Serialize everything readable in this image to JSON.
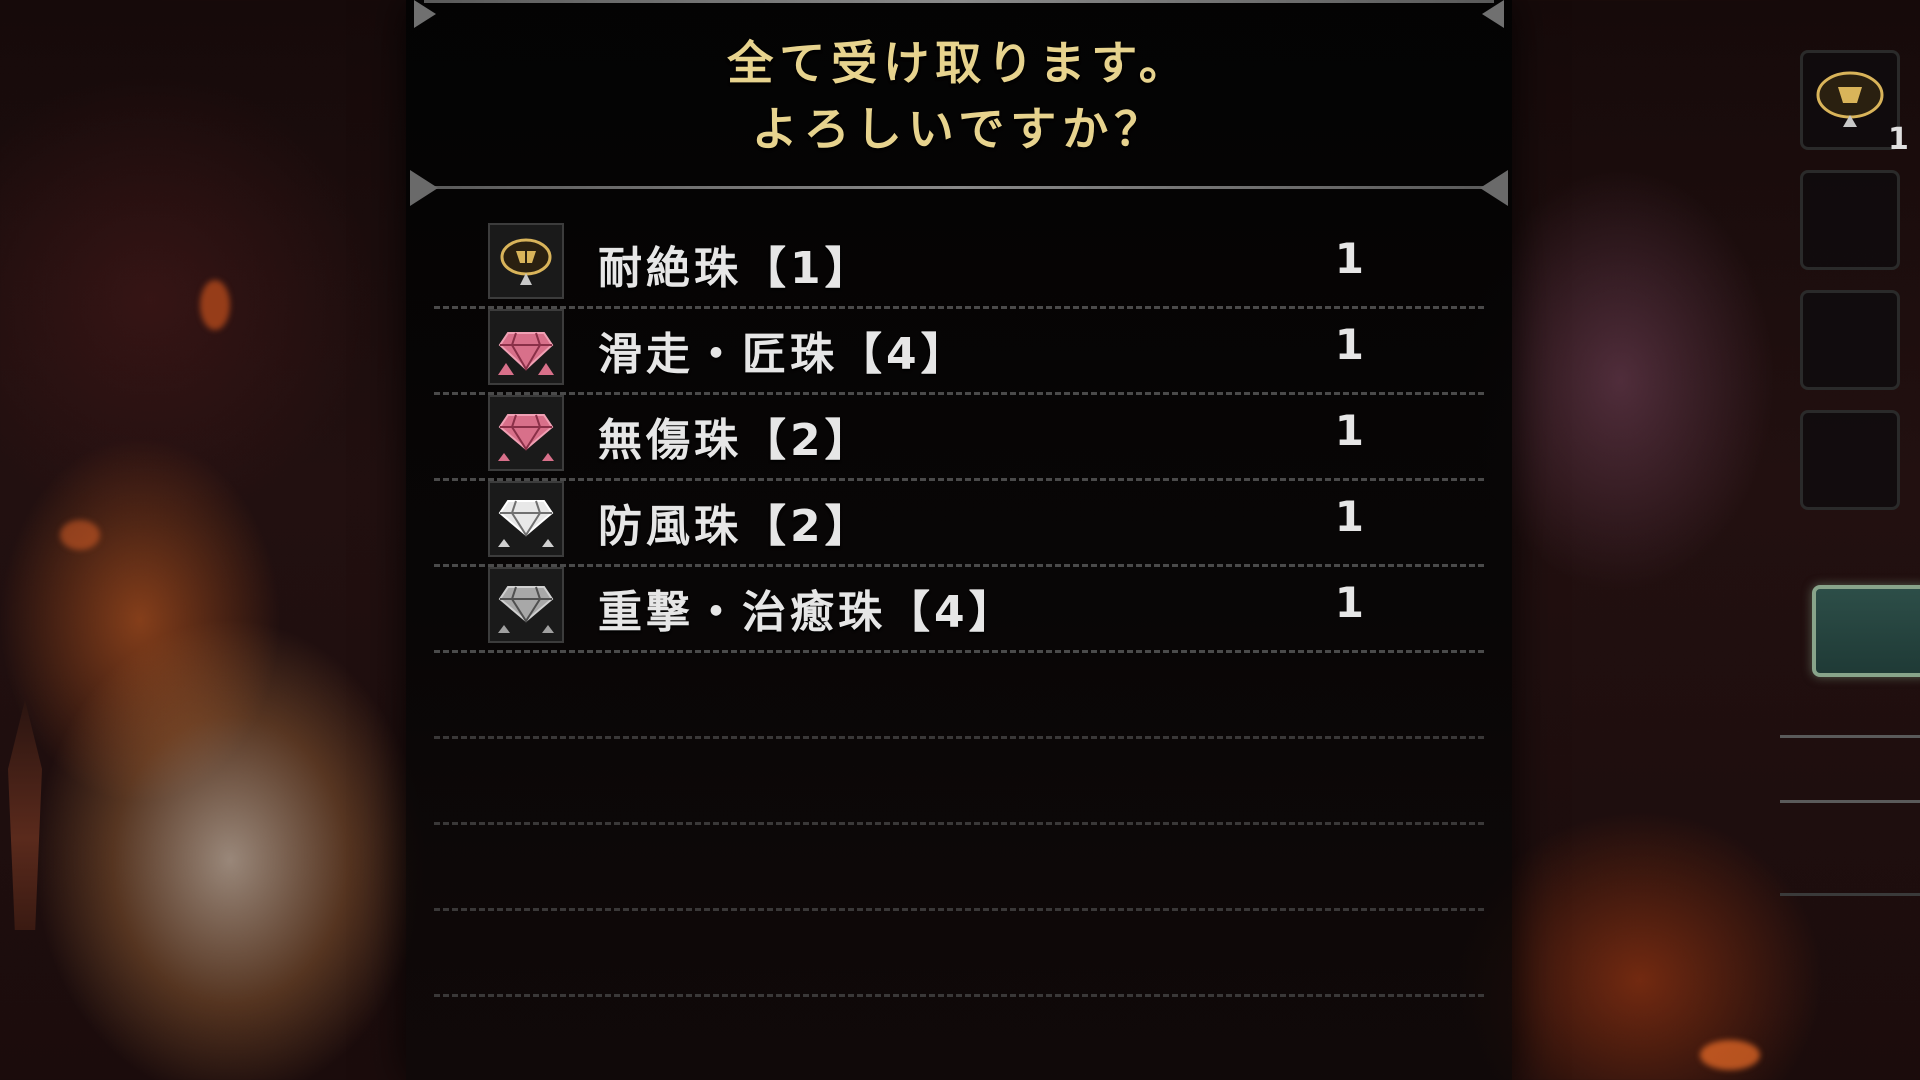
{
  "dialog": {
    "title_line1": "全て受け取ります。",
    "title_line2": "よろしいですか？",
    "items": [
      {
        "name": "耐絶珠【1】",
        "quantity": "1",
        "icon": "gold-decoration-gem-icon",
        "color": "#d9b45a"
      },
      {
        "name": "滑走・匠珠【4】",
        "quantity": "1",
        "icon": "pink-decoration-gem-icon",
        "color": "#e0708e"
      },
      {
        "name": "無傷珠【2】",
        "quantity": "1",
        "icon": "pink-decoration-gem-icon",
        "color": "#e0708e"
      },
      {
        "name": "防風珠【2】",
        "quantity": "1",
        "icon": "white-decoration-gem-icon",
        "color": "#e8e8e8"
      },
      {
        "name": "重撃・治癒珠【4】",
        "quantity": "1",
        "icon": "gray-decoration-gem-icon",
        "color": "#b0b0b0"
      }
    ]
  },
  "side_panel": {
    "first_slot_count": "1",
    "first_slot_icon": "gold-decoration-gem-icon"
  },
  "colors": {
    "title": "#e7d38e",
    "text": "#e6e6e6",
    "confirm_button_border": "#88a48a"
  }
}
